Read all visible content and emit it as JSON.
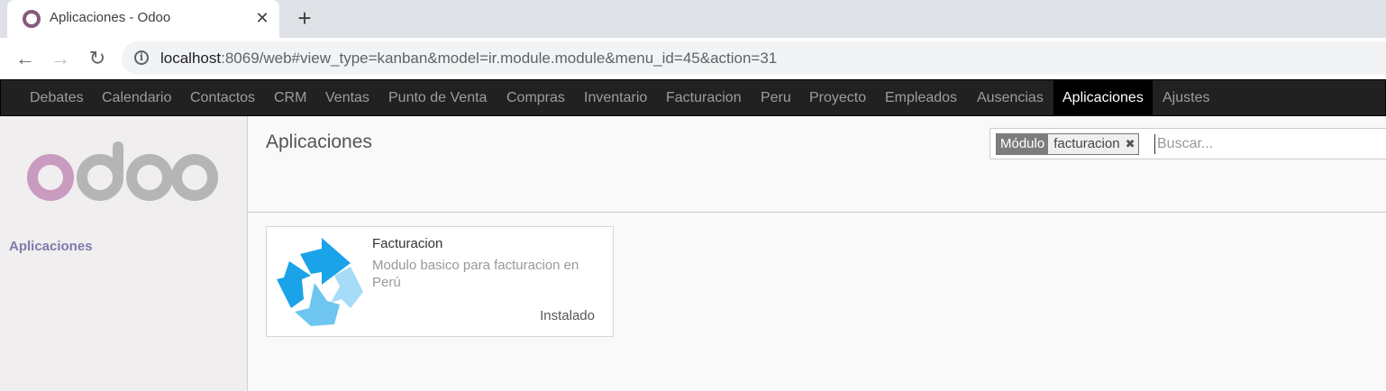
{
  "browser": {
    "tab_title": "Aplicaciones - Odoo",
    "tab_close": "✕",
    "new_tab": "+",
    "url_host": "localhost",
    "url_rest": ":8069/web#view_type=kanban&model=ir.module.module&menu_id=45&action=31"
  },
  "menu": {
    "items": [
      "Debates",
      "Calendario",
      "Contactos",
      "CRM",
      "Ventas",
      "Punto de Venta",
      "Compras",
      "Inventario",
      "Facturacion",
      "Peru",
      "Proyecto",
      "Empleados",
      "Ausencias",
      "Aplicaciones",
      "Ajustes"
    ],
    "active": "Aplicaciones"
  },
  "sidebar": {
    "logo_text": "odoo",
    "link": "Aplicaciones"
  },
  "control_panel": {
    "breadcrumb": "Aplicaciones",
    "facet_label": "Módulo",
    "facet_value": "facturacion",
    "facet_remove": "✖",
    "search_placeholder": "Buscar..."
  },
  "kanban": {
    "card": {
      "name": "Facturacion",
      "summary": "Modulo basico para facturacion en Perú",
      "status": "Instalado"
    }
  },
  "colors": {
    "odoo_purple": "#875a7b",
    "menu_bg": "#212121",
    "icon_blue": "#1aa3e8",
    "icon_light_blue": "#8ed2f5"
  }
}
